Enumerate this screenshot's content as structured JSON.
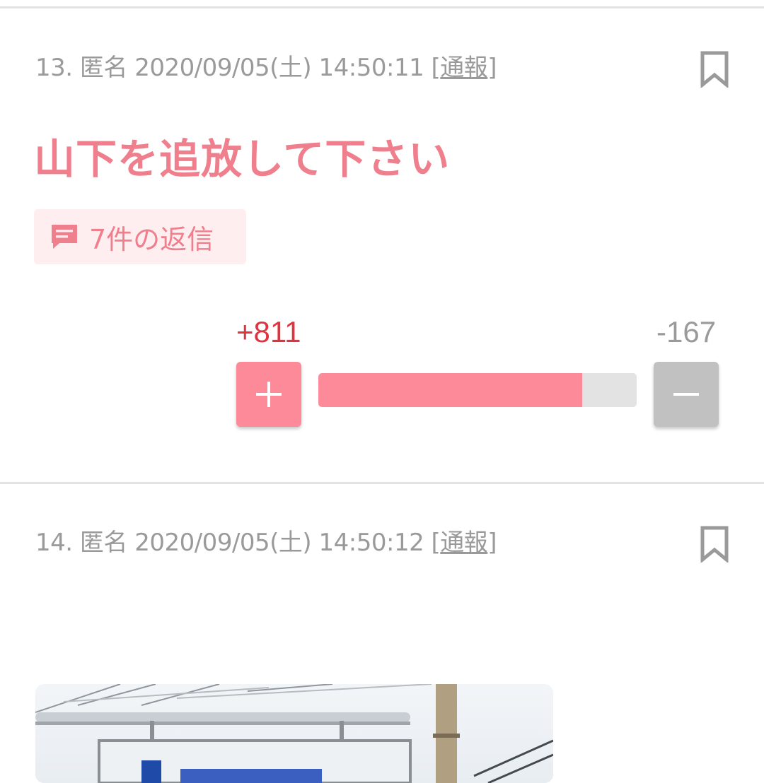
{
  "posts": [
    {
      "number": "13.",
      "author": "匿名",
      "datetime": "2020/09/05(土) 14:50:11",
      "report_open": "[",
      "report_label": "通報",
      "report_close": "]",
      "title": "山下を追放して下さい",
      "replies_label": "7件の返信",
      "plus_count": "+811",
      "minus_count": "-167",
      "approval_fraction": 0.829
    },
    {
      "number": "14.",
      "author": "匿名",
      "datetime": "2020/09/05(土) 14:50:12",
      "report_open": "[",
      "report_label": "通報",
      "report_close": "]"
    }
  ],
  "icons": {
    "bookmark": "bookmark-icon",
    "comment": "comment-icon",
    "plus": "plus-icon",
    "minus": "minus-icon"
  },
  "colors": {
    "accent": "#ef7f8d",
    "plus_button": "#fc8a98",
    "plus_count": "#e0333f",
    "minus_button": "#c1c1c1",
    "meta_text": "#9a9a9a"
  }
}
